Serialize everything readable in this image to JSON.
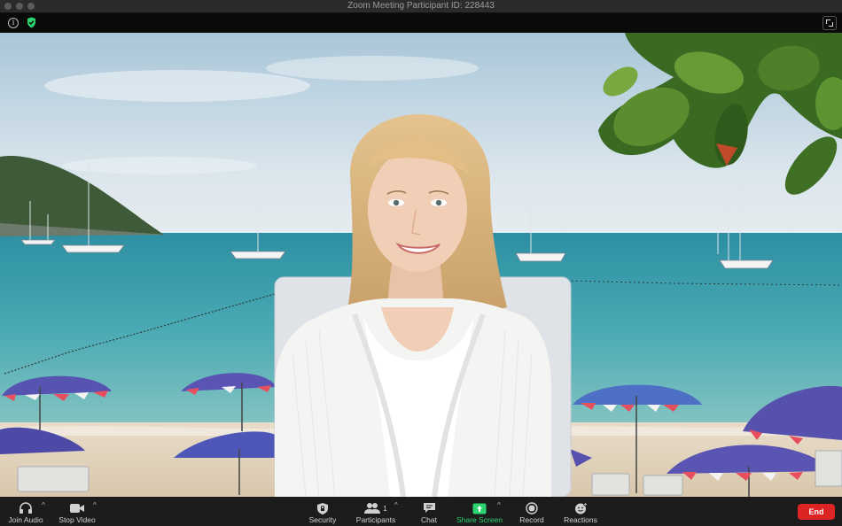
{
  "window": {
    "title": "Zoom Meeting Participant ID: 228443"
  },
  "toolbar": {
    "join_audio": "Join Audio",
    "stop_video": "Stop Video",
    "security": "Security",
    "participants": "Participants",
    "participant_count": "1",
    "chat": "Chat",
    "share_screen": "Share Screen",
    "record": "Record",
    "reactions": "Reactions",
    "end": "End"
  },
  "colors": {
    "end_button": "#dc2424",
    "share_screen_accent": "#2dd36f",
    "secure_shield": "#2dd36f"
  },
  "icons": [
    "info-icon",
    "shield-check-icon",
    "fullscreen-icon",
    "headphones-icon",
    "video-camera-icon",
    "security-shield-icon",
    "participants-icon",
    "chat-icon",
    "share-screen-icon",
    "record-icon",
    "reactions-icon"
  ]
}
